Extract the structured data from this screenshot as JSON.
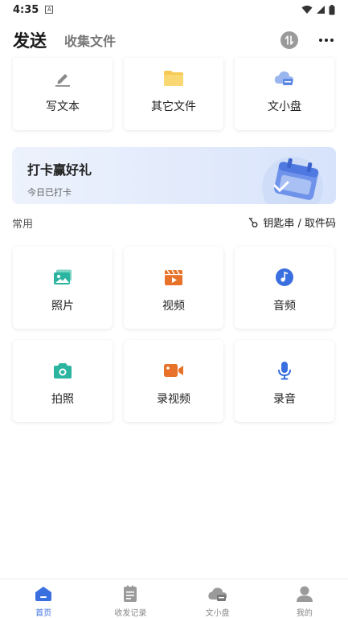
{
  "status_bar": {
    "time": "4:35",
    "notification": "A"
  },
  "header": {
    "active_tab": "发送",
    "inactive_tab": "收集文件"
  },
  "top_cards": [
    {
      "label": "写文本",
      "icon": "pencil-icon"
    },
    {
      "label": "其它文件",
      "icon": "folder-icon"
    },
    {
      "label": "文小盘",
      "icon": "cloud-disk-icon"
    }
  ],
  "banner": {
    "title": "打卡赢好礼",
    "subtitle": "今日已打卡"
  },
  "section": {
    "label": "常用",
    "key_link": "钥匙串 / 取件码"
  },
  "grid": [
    {
      "label": "照片",
      "icon": "photo-icon",
      "color": "#2bb5a0"
    },
    {
      "label": "视频",
      "icon": "video-clapper-icon",
      "color": "#e8722a"
    },
    {
      "label": "音频",
      "icon": "music-disc-icon",
      "color": "#3a6fe0"
    },
    {
      "label": "拍照",
      "icon": "camera-icon",
      "color": "#2bb5a0"
    },
    {
      "label": "录视频",
      "icon": "video-camera-icon",
      "color": "#e8722a"
    },
    {
      "label": "录音",
      "icon": "microphone-icon",
      "color": "#3a6fe0"
    }
  ],
  "bottom_nav": [
    {
      "label": "首页",
      "icon": "home-icon",
      "active": true
    },
    {
      "label": "收发记录",
      "icon": "records-icon",
      "active": false
    },
    {
      "label": "文小盘",
      "icon": "cloud-disk-icon",
      "active": false
    },
    {
      "label": "我的",
      "icon": "profile-icon",
      "active": false
    }
  ],
  "colors": {
    "accent": "#3a6fe0",
    "teal": "#2bb5a0",
    "orange": "#e8722a"
  }
}
